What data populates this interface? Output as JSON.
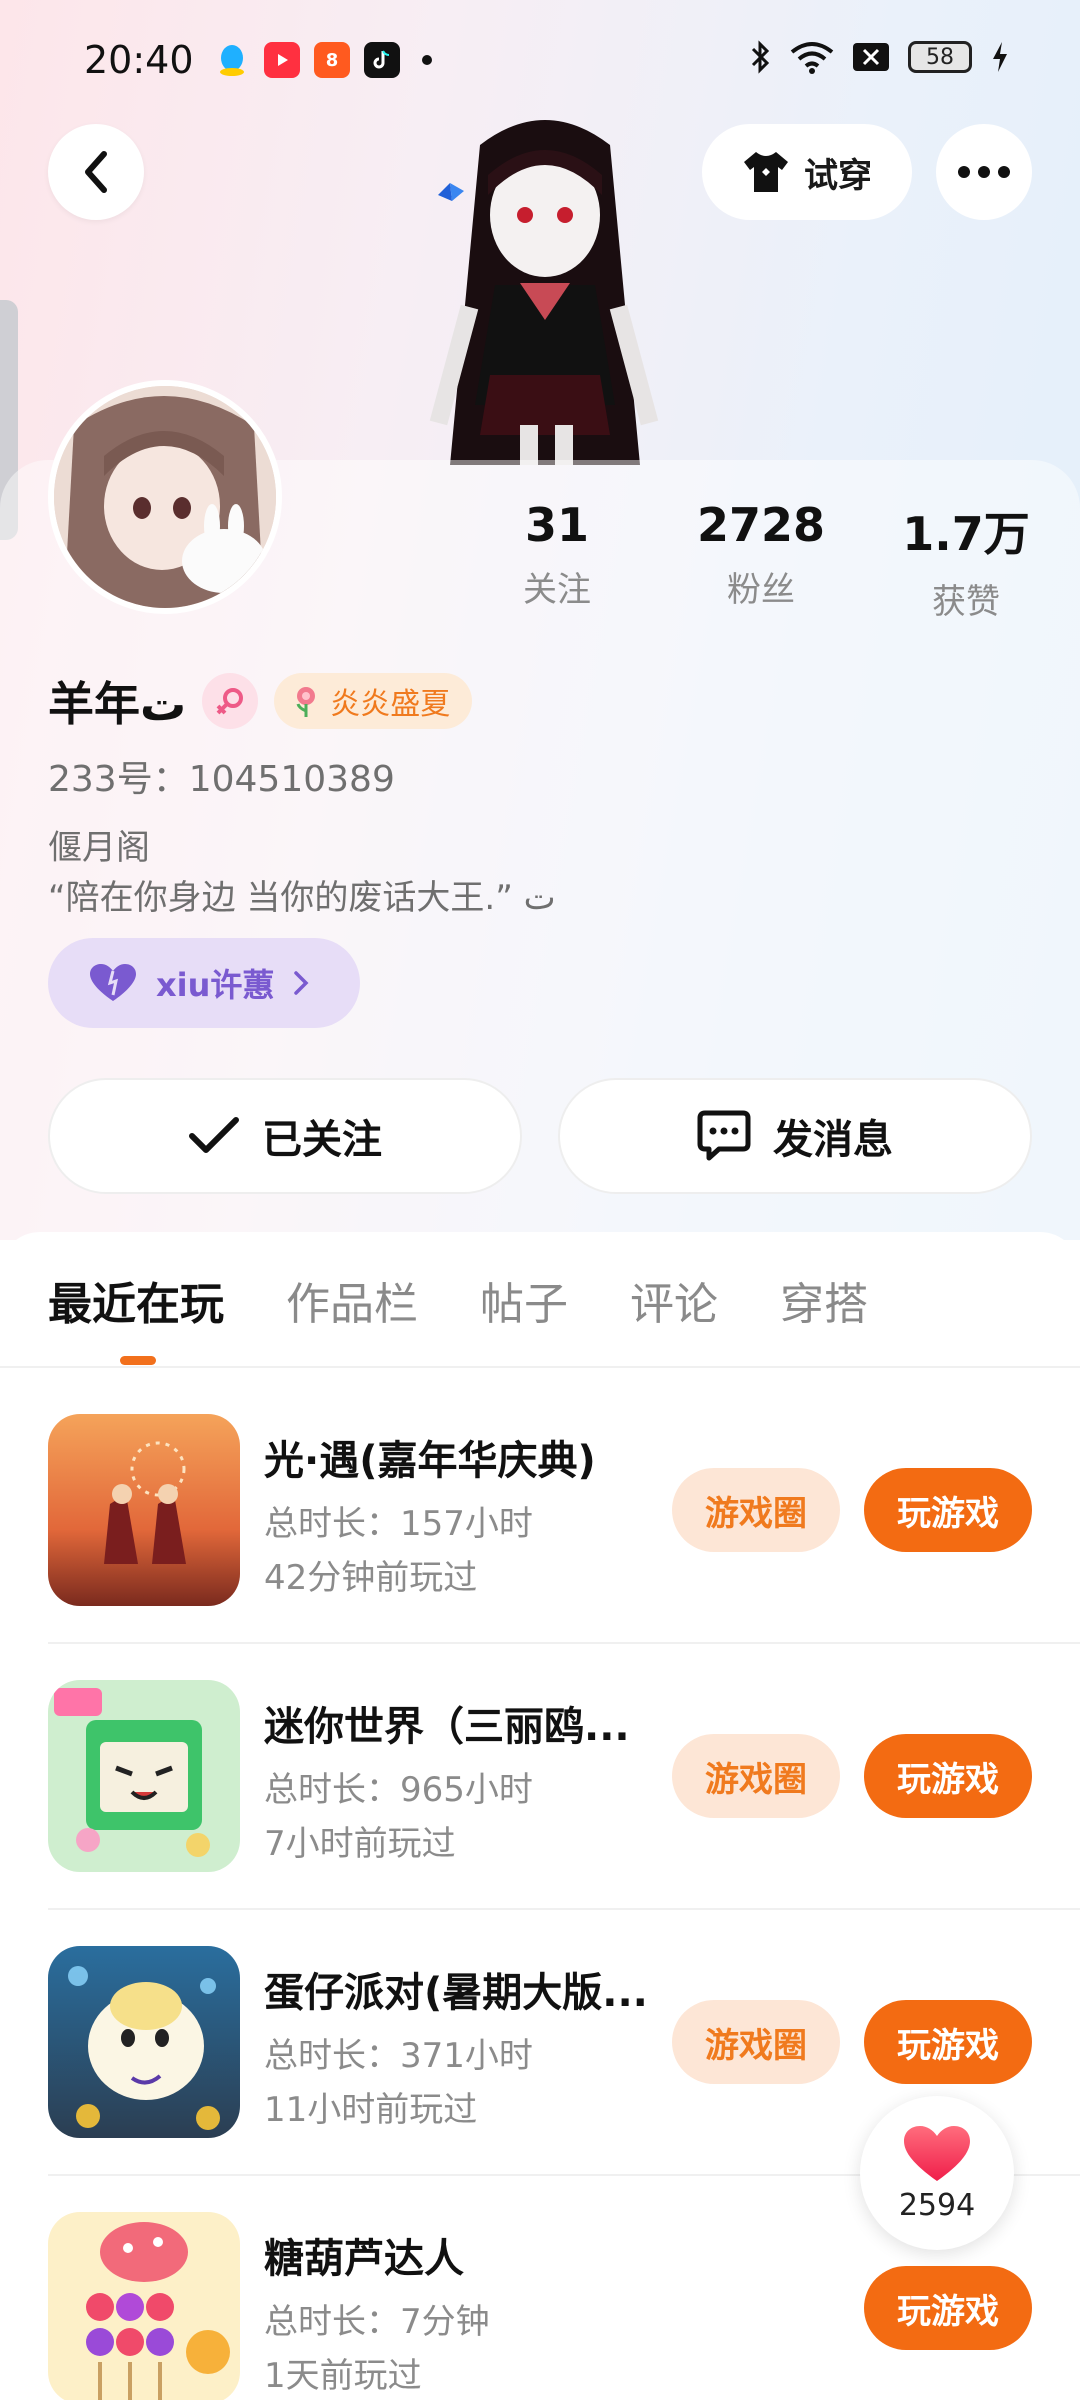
{
  "status_bar": {
    "time": "20:40",
    "battery": "58"
  },
  "header": {
    "tryon_label": "试穿"
  },
  "profile": {
    "stats": [
      {
        "value": "31",
        "label": "关注"
      },
      {
        "value": "2728",
        "label": "粉丝"
      },
      {
        "value": "1.7万",
        "label": "获赞"
      }
    ],
    "username": "羊年ت",
    "season_badge": "炎炎盛夏",
    "uid": "233号：104510389",
    "bio_line1": "偃月阁",
    "bio_line2": "“陪在你身边  当你的废话大王.” ت",
    "cp_label": "xiu许蕙",
    "follow_label": "已关注",
    "message_label": "发消息"
  },
  "tabs": [
    "最近在玩",
    "作品栏",
    "帖子",
    "评论",
    "穿搭"
  ],
  "games": [
    {
      "title": "光·遇(嘉年华庆典)",
      "duration": "总时长：157小时",
      "last_played": "42分钟前玩过",
      "circle_label": "游戏圈",
      "play_label": "玩游戏"
    },
    {
      "title": "迷你世界（三丽鸥...",
      "duration": "总时长：965小时",
      "last_played": "7小时前玩过",
      "circle_label": "游戏圈",
      "play_label": "玩游戏"
    },
    {
      "title": "蛋仔派对(暑期大版...",
      "duration": "总时长：371小时",
      "last_played": "11小时前玩过",
      "circle_label": "游戏圈",
      "play_label": "玩游戏"
    },
    {
      "title": "糖葫芦达人",
      "duration": "总时长：7分钟",
      "last_played": "1天前玩过",
      "play_label": "玩游戏"
    }
  ],
  "like_count": "2594",
  "colors": {
    "accent": "#f36b12",
    "accent_soft": "#fde6d6",
    "cp_purple": "#7a5ad0"
  }
}
